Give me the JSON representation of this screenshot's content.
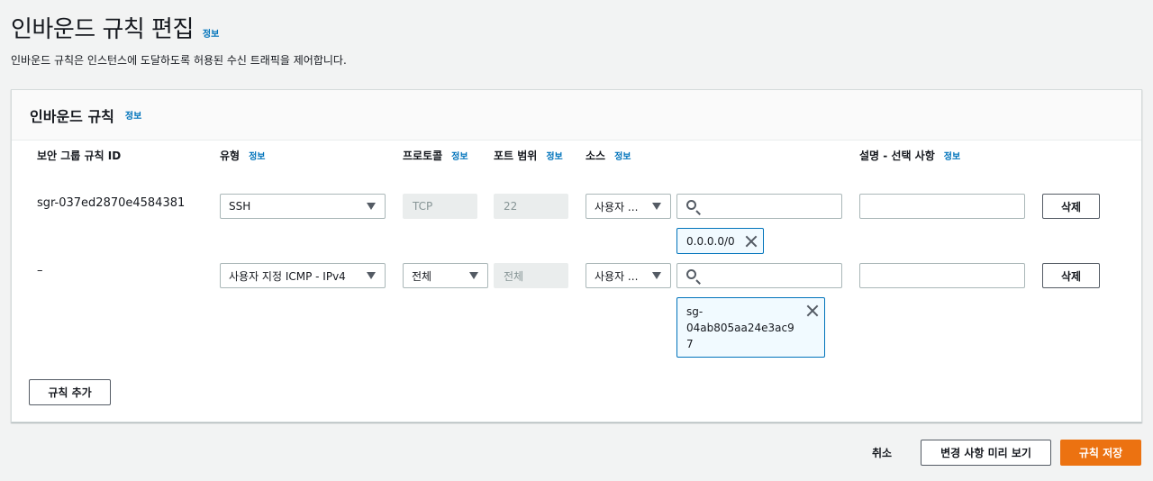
{
  "header": {
    "title": "인바운드 규칙 편집",
    "info": "정보",
    "description": "인바운드 규칙은 인스턴스에 도달하도록 허용된 수신 트래픽을 제어합니다."
  },
  "panel": {
    "title": "인바운드 규칙",
    "info": "정보",
    "columns": {
      "rule_id": "보안 그룹 규칙 ID",
      "type": "유형",
      "protocol": "프로토콜",
      "port_range": "포트 범위",
      "source": "소스",
      "description": "설명 - 선택 사항",
      "info": "정보"
    },
    "rows": [
      {
        "rule_id": "sgr-037ed2870e4584381",
        "type": "SSH",
        "protocol": "TCP",
        "port_range": "22",
        "source_type": "사용자 ...",
        "search_value": "",
        "token": "0.0.0.0/0",
        "description": "",
        "delete_label": "삭제"
      },
      {
        "rule_id": "–",
        "type": "사용자 지정 ICMP - IPv4",
        "protocol": "전체",
        "port_range": "전체",
        "source_type": "사용자 ...",
        "search_value": "",
        "token_line1": "sg-",
        "token_line2": "04ab805aa24e3ac9",
        "token_line3": "7",
        "description": "",
        "delete_label": "삭제"
      }
    ],
    "add_rule_label": "규칙 추가"
  },
  "footer": {
    "cancel_label": "취소",
    "preview_label": "변경 사항 미리 보기",
    "save_label": "규칙 저장"
  },
  "icons": {
    "dropdown": "caret-down-icon",
    "search": "search-icon",
    "remove": "close-icon"
  },
  "colors": {
    "link": "#0073bb",
    "primary": "#ec7211",
    "token_border": "#0073bb",
    "token_bg": "#f1faff"
  }
}
